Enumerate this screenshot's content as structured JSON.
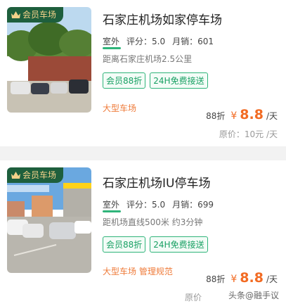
{
  "colors": {
    "accent": "#f26b23",
    "green": "#2fb47a",
    "badge_bg": "#1e5f3d",
    "badge_text": "#f4d28a"
  },
  "listings": [
    {
      "badge": "会员车场",
      "title": "石家庄机场如家停车场",
      "location_type": "室外",
      "rating": "评分：5.0",
      "monthly_sales": "月销：601",
      "distance": "距离石家庄机场2.5公里",
      "tags": [
        "会员88折",
        "24H免费接送"
      ],
      "features": "大型车场",
      "discount": "88折",
      "currency": "¥",
      "price": "8.8",
      "unit": "/天",
      "original_price": "原价：10元 /天"
    },
    {
      "badge": "会员车场",
      "title": "石家庄机场IU停车场",
      "location_type": "室外",
      "rating": "评分：5.0",
      "monthly_sales": "月销：699",
      "distance": "距机场直线500米 约3分钟",
      "tags": [
        "会员88折",
        "24H免费接送"
      ],
      "features": "大型车场 管理规范",
      "discount": "88折",
      "currency": "¥",
      "price": "8.8",
      "unit": "/天",
      "original_price": "原价"
    }
  ],
  "watermark": "头条@融手议",
  "icons": {
    "badge_icon": "crown-icon"
  }
}
